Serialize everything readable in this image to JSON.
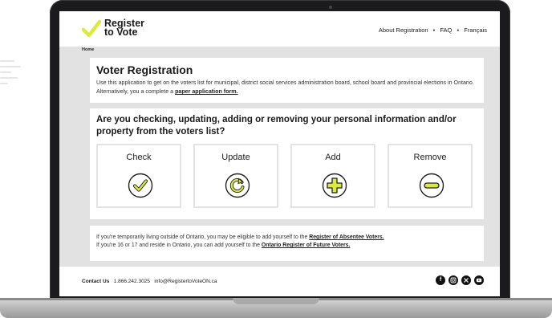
{
  "header": {
    "logo_line1": "Register",
    "logo_line2": "to Vote",
    "nav": [
      "About Registration",
      "FAQ",
      "Français"
    ]
  },
  "breadcrumb": "Home",
  "intro": {
    "title": "Voter Registration",
    "text": "Use this application to get on the voters list for municipal, district social services administration board, school board and provincial elections in Ontario. Alternatively, you a complete a ",
    "link": "paper application form."
  },
  "question": {
    "title": "Are you checking, updating, adding or removing your personal information and/or property from the voters list?",
    "options": [
      {
        "label": "Check",
        "icon": "check-icon"
      },
      {
        "label": "Update",
        "icon": "refresh-icon"
      },
      {
        "label": "Add",
        "icon": "plus-icon"
      },
      {
        "label": "Remove",
        "icon": "minus-icon"
      }
    ]
  },
  "info": {
    "line1_text": "If you're temporarily living outside of Ontario, you may be eligible to add yourself to the ",
    "line1_link": "Register of Absentee Voters.",
    "line2_text": "If you're 16 or 17 and reside in Ontario, you can add yourself to the ",
    "line2_link": "Ontario Register of Future Voters."
  },
  "footer": {
    "contact_label": "Contact Us",
    "phone": "1.866.242.3025",
    "email": "info@RegistertoVoteON.ca",
    "social": [
      "facebook-icon",
      "instagram-icon",
      "x-icon",
      "youtube-icon"
    ]
  },
  "colors": {
    "accent": "#d9ec3c",
    "icon_stroke": "#222222",
    "background": "#e2e2e2"
  }
}
